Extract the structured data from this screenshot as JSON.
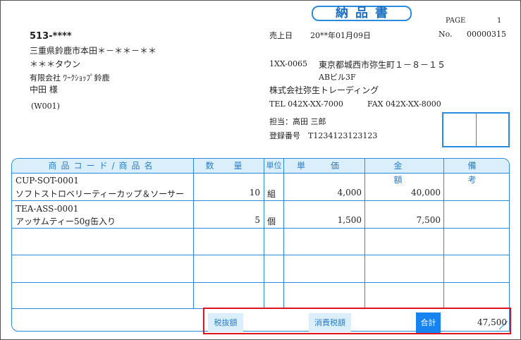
{
  "header": {
    "title": "納品書",
    "page_label": "PAGE",
    "page_number": "1",
    "sales_date_label": "売上日",
    "sales_date": "20**年01月09日",
    "no_label": "No.",
    "no_value": "00000315"
  },
  "customer": {
    "zip": "513-****",
    "address1": "三重県鈴鹿市本田＊－＊＊－＊＊",
    "address2": "＊＊＊タウン",
    "company": "有限会社 ﾜｰｸｼｮｯﾌﾟ鈴鹿",
    "person": "中田 様",
    "code": "(W001)"
  },
  "sender": {
    "zip": "1XX-0065",
    "address1": "東京都城西市弥生町１－８－１５",
    "address2": "ABビル3F",
    "company": "株式会社弥生トレーディング",
    "tel": "TEL 042X-XX-7000",
    "fax": "FAX 042X-XX-8000",
    "staff": "担当：高田 三郎",
    "registration": "登録番号　T1234123123123"
  },
  "table": {
    "headers": {
      "product": "商品コード/商品名",
      "qty": "数量",
      "unit": "単位",
      "price": "単価",
      "amount": "金額",
      "remarks": "備考"
    },
    "rows": [
      {
        "code": "CUP-SOT-0001",
        "name": "ソフトストロベリーティーカップ＆ソーサー",
        "qty": "10",
        "unit": "組",
        "price": "4,000",
        "amount": "40,000"
      },
      {
        "code": "TEA-ASS-0001",
        "name": "アッサムティー50g缶入り",
        "qty": "5",
        "unit": "個",
        "price": "1,500",
        "amount": "7,500"
      }
    ]
  },
  "totals": {
    "tax_excluded_label": "税抜額",
    "tax_excluded_value": "",
    "consumption_tax_label": "消費税額",
    "consumption_tax_value": "",
    "total_label": "合計",
    "total_value": "47,500"
  },
  "colors": {
    "accent": "#2a8be0",
    "header_fill": "#dbeefb",
    "highlight": "#e0141e",
    "total_fill": "#1783f0"
  }
}
